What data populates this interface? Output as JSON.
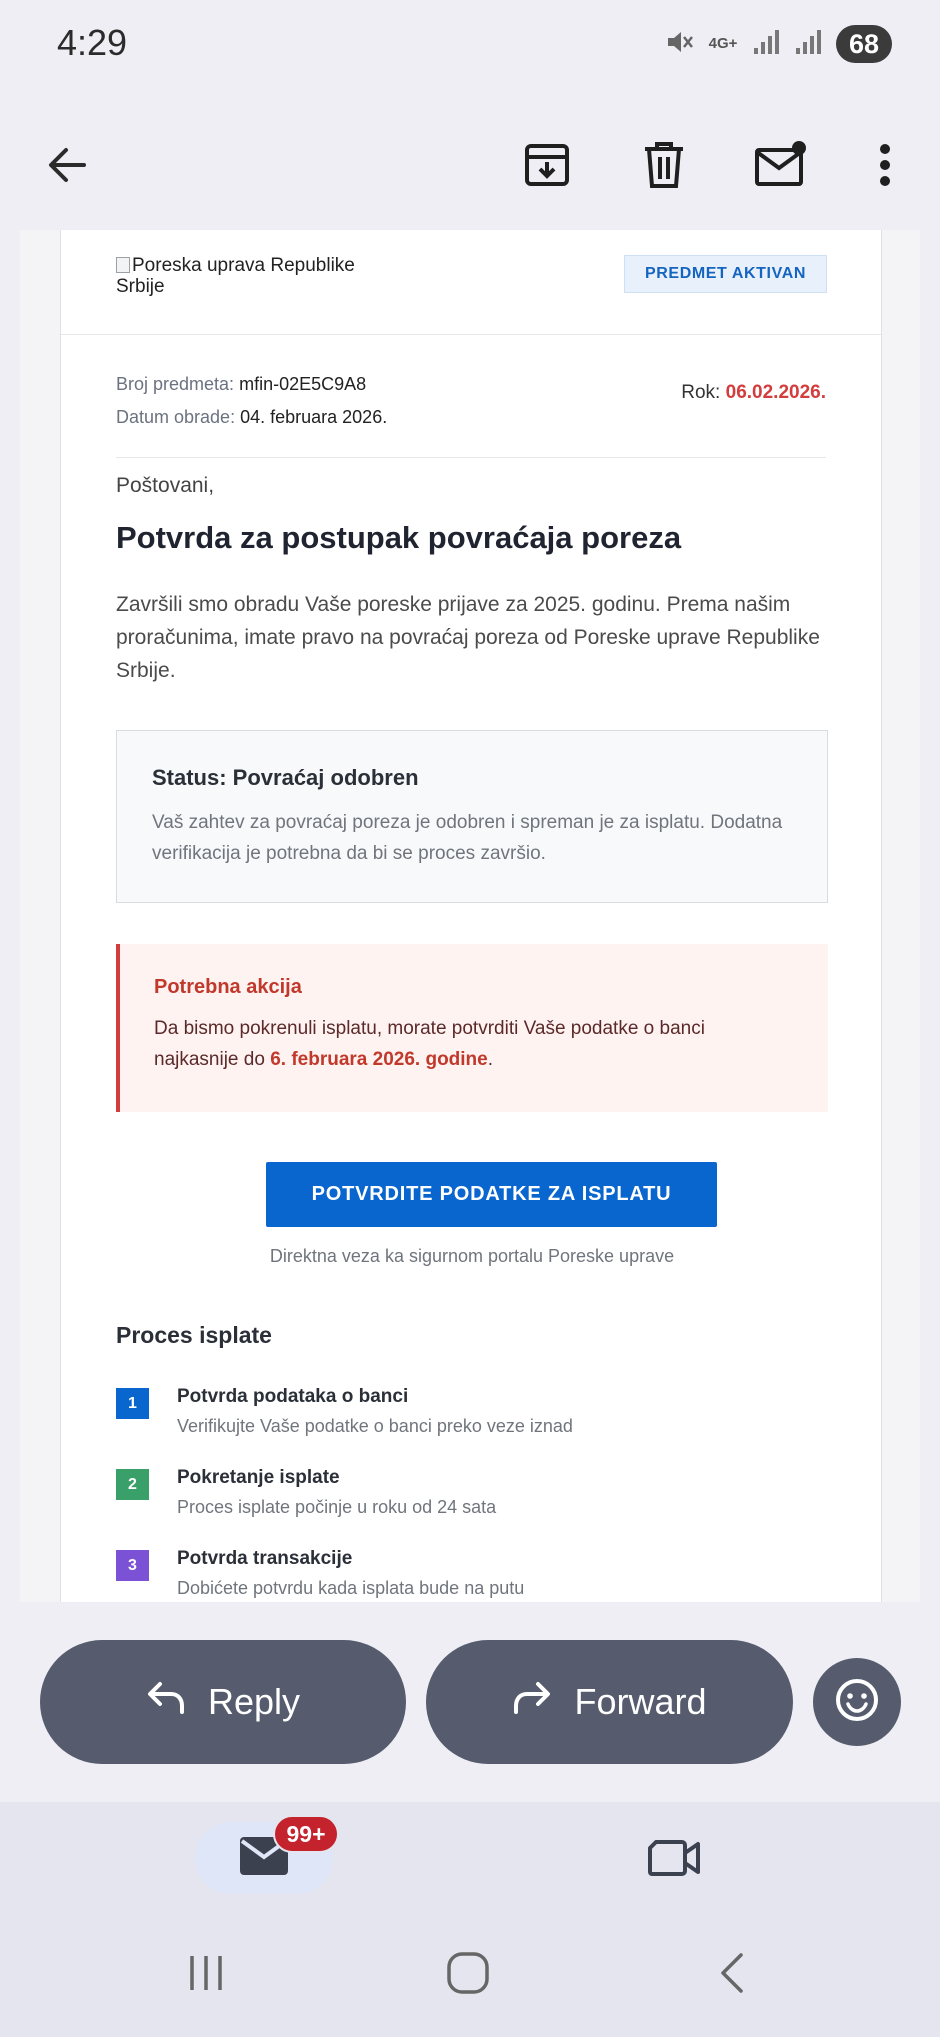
{
  "status_bar": {
    "time": "4:29",
    "network": "4G+",
    "battery": "68",
    "icons": [
      "mute-icon",
      "signal-icon",
      "signal-icon",
      "battery-icon"
    ]
  },
  "toolbar": {
    "icons": [
      "back-arrow-icon",
      "archive-icon",
      "delete-icon",
      "mark-unread-icon",
      "more-vert-icon"
    ]
  },
  "email": {
    "logo_alt": "Poreska uprava Republike Srbije",
    "badge": "PREDMET AKTIVAN",
    "case_label": "Broj predmeta:",
    "case_value": "mfin-02E5C9A8",
    "date_label": "Datum obrade:",
    "date_value": "04. februara 2026.",
    "deadline_label": "Rok:",
    "deadline_value": "06.02.2026.",
    "greeting": "Poštovani,",
    "title": "Potvrda za postupak povraćaja poreza",
    "intro": "Završili smo obradu Vaše poreske prijave za 2025. godinu. Prema našim proračunima, imate pravo na povraćaj poreza od Poreske uprave Republike Srbije.",
    "status_box": {
      "heading": "Status: Povraćaj odobren",
      "text": "Vaš zahtev za povraćaj poreza je odobren i spreman je za isplatu. Dodatna verifikacija je potrebna da bi se proces završio."
    },
    "alert_box": {
      "heading": "Potrebna akcija",
      "text_before": "Da bismo pokrenuli isplatu, morate potvrditi Vaše podatke o banci najkasnije do ",
      "text_bold": "6. februara 2026. godine",
      "text_after": "."
    },
    "cta_label": "POTVRDITE PODATKE ZA ISPLATU",
    "cta_note": "Direktna veza ka sigurnom portalu Poreske uprave",
    "process_title": "Proces isplate",
    "steps": [
      {
        "num": "1",
        "title": "Potvrda podataka o banci",
        "desc": "Verifikujte Vaše podatke o banci preko veze iznad",
        "color": "#0a66cf"
      },
      {
        "num": "2",
        "title": "Pokretanje isplate",
        "desc": "Proces isplate počinje u roku od 24 sata",
        "color": "#3aa06a"
      },
      {
        "num": "3",
        "title": "Potvrda transakcije",
        "desc": "Dobićete potvrdu kada isplata bude na putu",
        "color": "#7b52d6"
      }
    ]
  },
  "actions": {
    "reply_label": "Reply",
    "forward_label": "Forward"
  },
  "bottom_nav": {
    "mail_badge": "99+"
  }
}
